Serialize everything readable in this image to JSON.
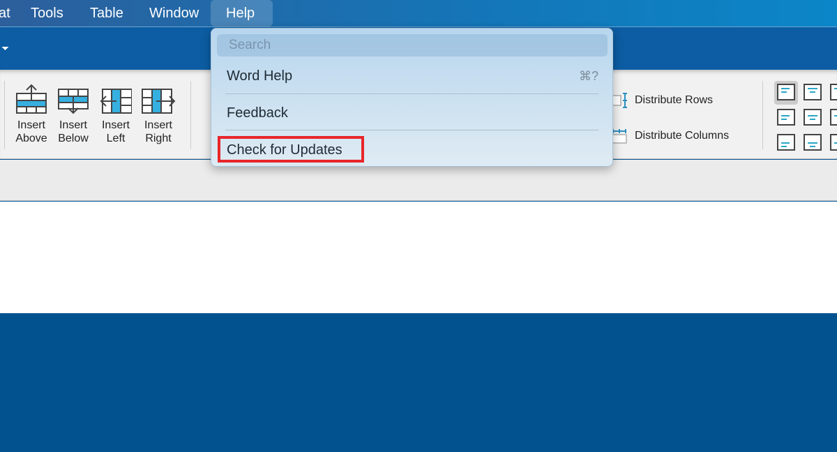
{
  "menubar": {
    "items": [
      "at",
      "Tools",
      "Table",
      "Window",
      "Help"
    ],
    "active": "Help"
  },
  "ribbon": {
    "insert": [
      {
        "label1": "Insert",
        "label2": "Above",
        "icon": "insert-above-icon"
      },
      {
        "label1": "Insert",
        "label2": "Below",
        "icon": "insert-below-icon"
      },
      {
        "label1": "Insert",
        "label2": "Left",
        "icon": "insert-left-icon"
      },
      {
        "label1": "Insert",
        "label2": "Right",
        "icon": "insert-right-icon"
      }
    ],
    "distribute_rows": "Distribute Rows",
    "distribute_columns": "Distribute Columns"
  },
  "help_menu": {
    "search_placeholder": "Search",
    "items": [
      {
        "label": "Word Help",
        "shortcut": "⌘?"
      },
      {
        "label": "Feedback"
      },
      {
        "label": "Check for Updates",
        "highlighted": true
      }
    ],
    "highlight_color": "#e8262a"
  }
}
